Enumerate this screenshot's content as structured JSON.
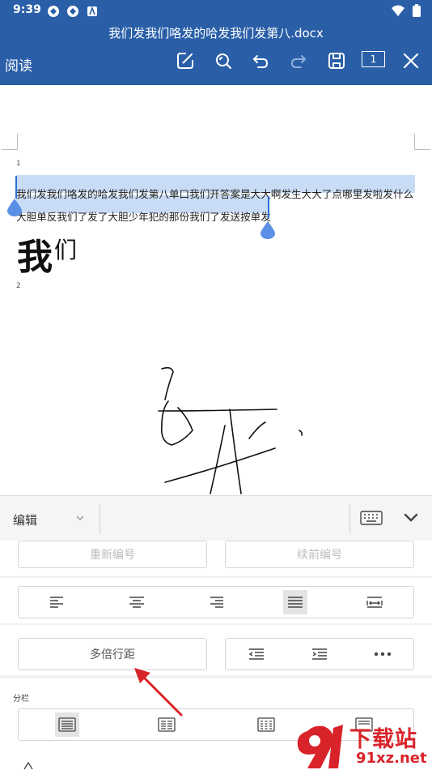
{
  "status_bar": {
    "time": "9:39"
  },
  "title_bar": {
    "doc_title": "我们发我们咯发的哈发我们发第八.docx",
    "read_label": "阅读",
    "page_number": "1"
  },
  "document": {
    "page1_number": "1",
    "page2_number": "2",
    "line1": "我们发我们咯发的哈发我们发第八单口我们开答案是大大啊发生大大了点哪里发啦发什么",
    "line2": "大胆单反我们了发了大胆少年犯的那份我们了发送按单发",
    "big_text_main": "我",
    "big_text_small": "们"
  },
  "edit_panel": {
    "mode_label": "编辑",
    "renumber_label": "重新编号",
    "continue_numbering_label": "续前编号",
    "multiple_line_spacing_label": "多倍行距",
    "columns_label": "分栏"
  },
  "watermark": {
    "brand_text": "下载站",
    "url_text": "91xz.net"
  },
  "colors": {
    "primary": "#2a5fa8",
    "selection": "#c9dcf5",
    "handle": "#5b8fe6",
    "arrow": "#d8232a"
  }
}
